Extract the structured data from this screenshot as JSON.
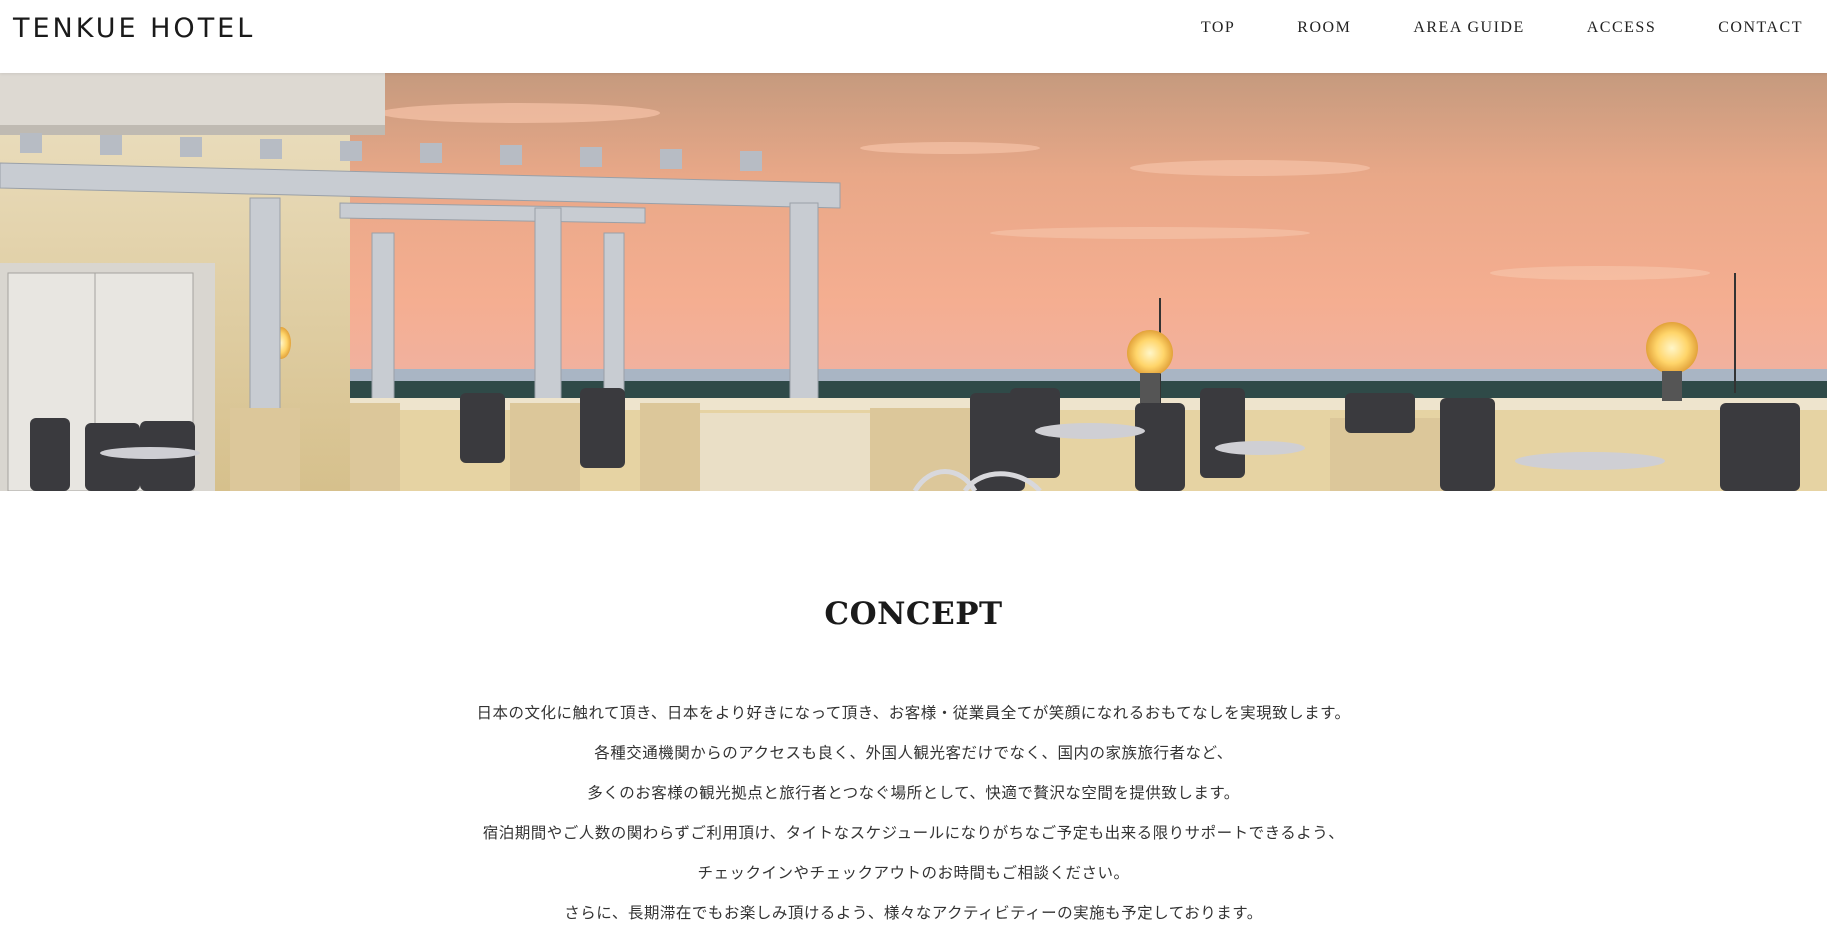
{
  "header": {
    "logo": "TENKUE HOTEL",
    "nav": [
      "TOP",
      "ROOM",
      "AREA GUIDE",
      "ACCESS",
      "CONTACT"
    ]
  },
  "hero": {
    "scene": "rooftop-terrace-sunset-photo"
  },
  "concept": {
    "title": "CONCEPT",
    "lines": [
      "日本の文化に触れて頂き、日本をより好きになって頂き、お客様・従業員全てが笑顔になれるおもてなしを実現致します。",
      "各種交通機関からのアクセスも良く、外国人観光客だけでなく、国内の家族旅行者など、",
      "多くのお客様の観光拠点と旅行者とつなぐ場所として、快適で贅沢な空間を提供致します。",
      "宿泊期間やご人数の関わらずご利用頂け、タイトなスケジュールになりがちなご予定も出来る限りサポートできるよう、",
      "チェックインやチェックアウトのお時間もご相談ください。",
      "さらに、長期滞在でもお楽しみ頂けるよう、様々なアクティビティーの実施も予定しております。"
    ]
  },
  "colors": {
    "sky_top": "#c9a184",
    "sky_mid": "#f3ad8e",
    "sky_low": "#eab1a3",
    "horizon": "#9db1c4",
    "treeline": "#2f4a48",
    "pergola": "#c7ccd3",
    "wall": "#e3cf9e"
  }
}
